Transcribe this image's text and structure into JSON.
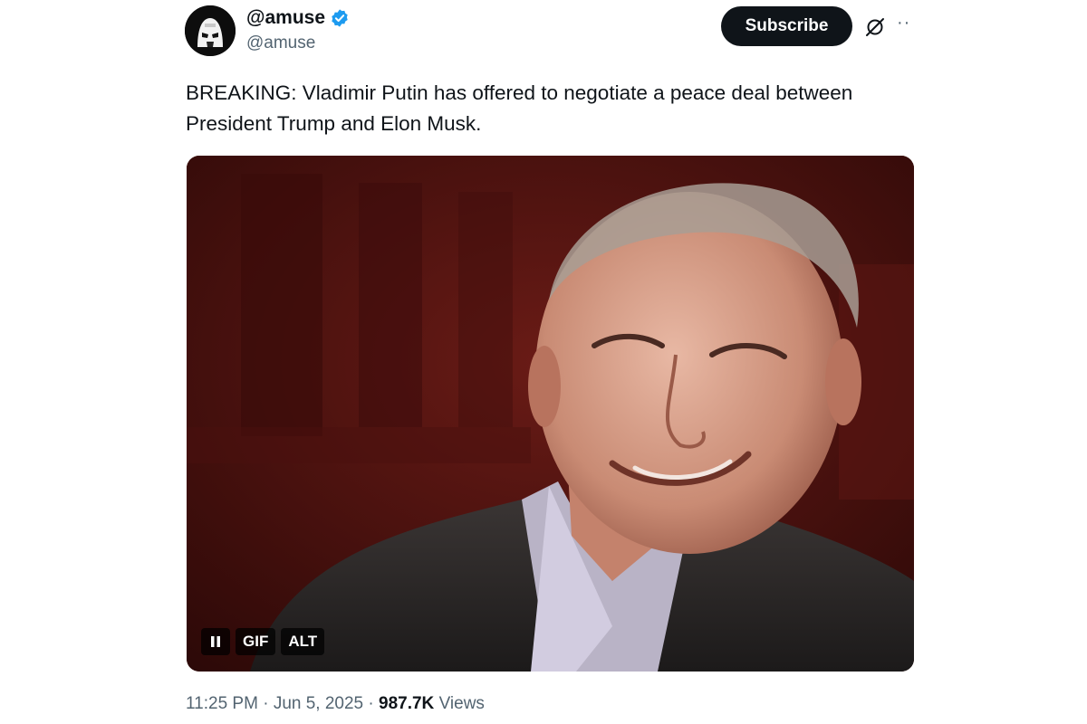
{
  "author": {
    "display_name": "@amuse",
    "handle": "@amuse",
    "verified": true
  },
  "header": {
    "subscribe_label": "Subscribe",
    "grok_icon": "grok-icon",
    "more_icon": "more-icon"
  },
  "tweet": {
    "text_line1": "BREAKING: Vladimir Putin has offered to negotiate a peace deal between",
    "text_line2": "President Trump and Elon Musk."
  },
  "media": {
    "controls": {
      "pause_icon": "pause-icon",
      "gif_label": "GIF",
      "alt_label": "ALT"
    }
  },
  "meta": {
    "time": "11:25 PM",
    "separator1": " · ",
    "date": "Jun 5, 2025",
    "separator2": " · ",
    "views_count": "987.7K",
    "views_label": " Views"
  },
  "colors": {
    "text_primary": "#0f1419",
    "text_secondary": "#536471",
    "verified_blue": "#1d9bf0",
    "subscribe_bg": "#0f1419"
  }
}
